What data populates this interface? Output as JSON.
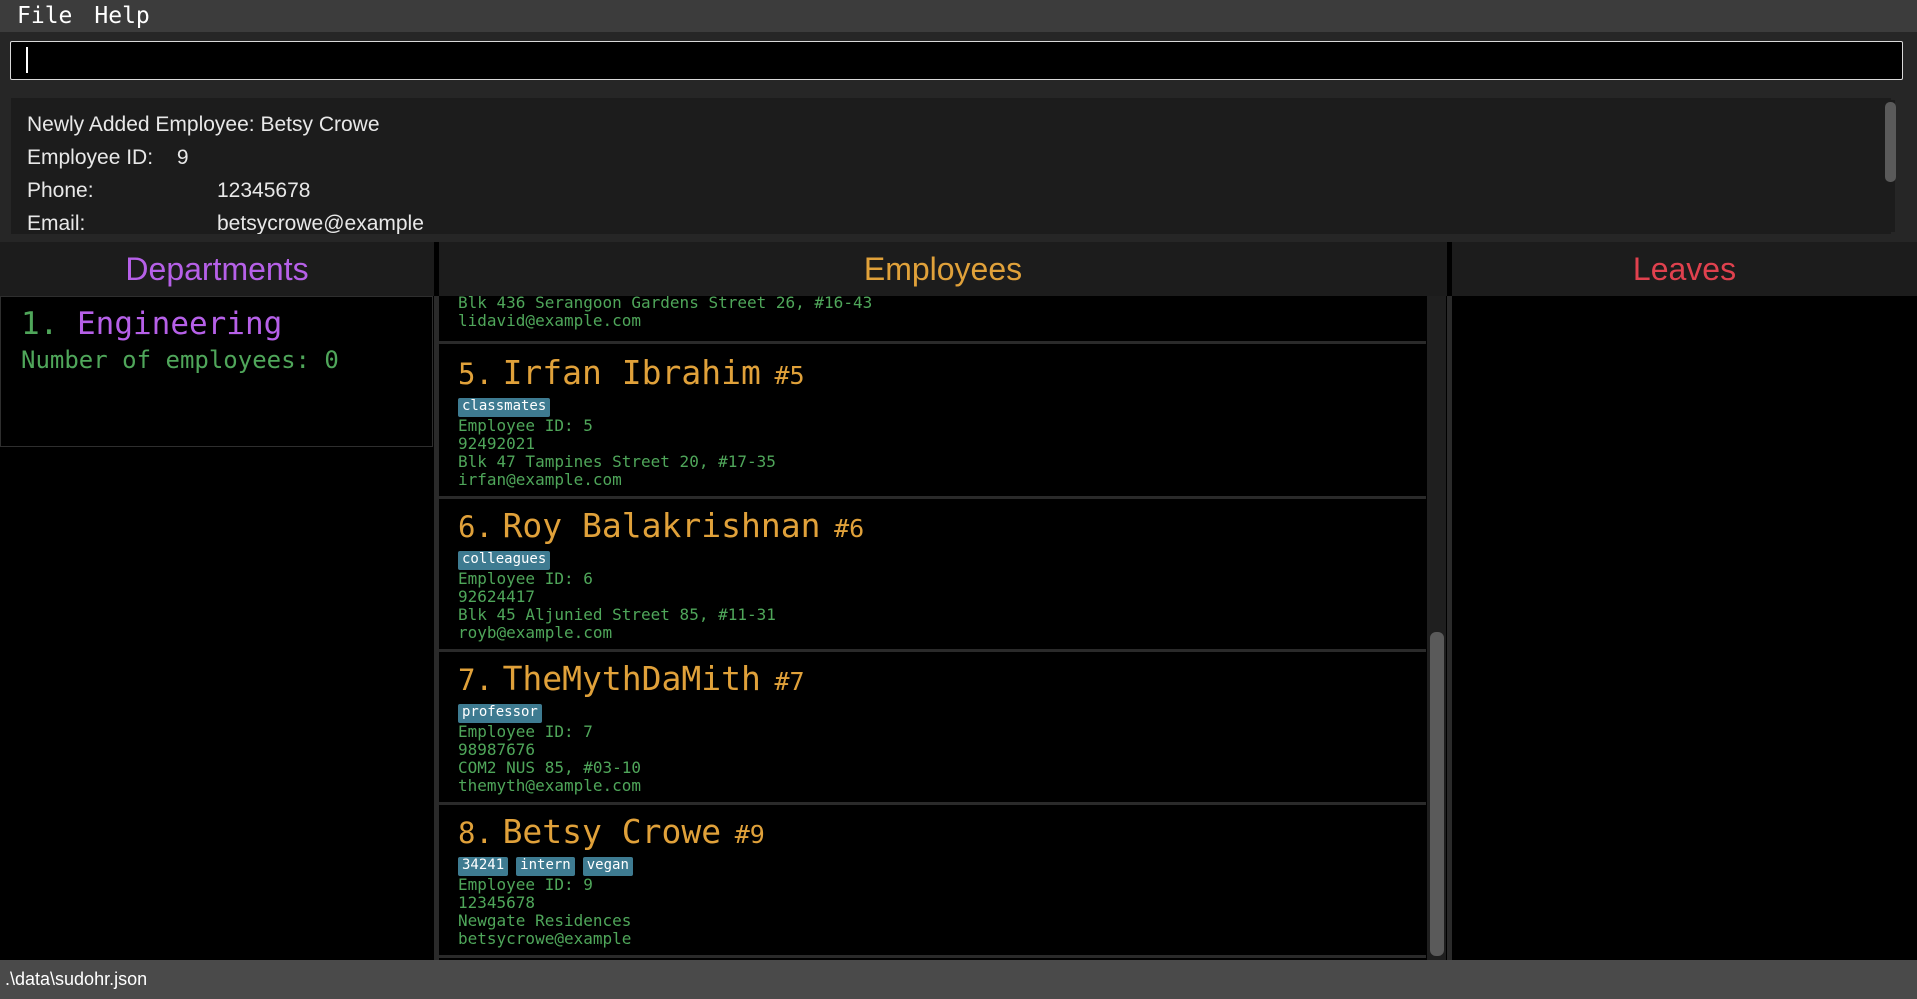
{
  "menu": {
    "file": "File",
    "help": "Help"
  },
  "command": {
    "value": ""
  },
  "result": {
    "line1": "Newly Added Employee: Betsy Crowe",
    "id_label": "Employee ID:",
    "id_value": "9",
    "phone_label": "Phone:",
    "phone_value": "12345678",
    "email_label": "Email:",
    "email_value": "betsycrowe@example"
  },
  "headers": {
    "departments": "Departments",
    "employees": "Employees",
    "leaves": "Leaves",
    "colors": {
      "departments": "#b660e8",
      "employees": "#e0a13a",
      "leaves": "#e0414e"
    }
  },
  "departments": [
    {
      "index": "1.",
      "name": "Engineering",
      "count": "Number of employees: 0"
    }
  ],
  "employees_partial": {
    "address": "Blk 436 Serangoon Gardens Street 26, #16-43",
    "email": "lidavid@example.com"
  },
  "employees": [
    {
      "index": "5.",
      "name": "Irfan Ibrahim",
      "id_tag": "#5",
      "tags": [
        "classmates"
      ],
      "emp_id": "Employee ID: 5",
      "phone": "92492021",
      "address": "Blk 47 Tampines Street 20, #17-35",
      "email": "irfan@example.com"
    },
    {
      "index": "6.",
      "name": "Roy Balakrishnan",
      "id_tag": "#6",
      "tags": [
        "colleagues"
      ],
      "emp_id": "Employee ID: 6",
      "phone": "92624417",
      "address": "Blk 45 Aljunied Street 85, #11-31",
      "email": "royb@example.com"
    },
    {
      "index": "7.",
      "name": "TheMythDaMith",
      "id_tag": "#7",
      "tags": [
        "professor"
      ],
      "emp_id": "Employee ID: 7",
      "phone": "98987676",
      "address": "COM2 NUS 85, #03-10",
      "email": "themyth@example.com"
    },
    {
      "index": "8.",
      "name": "Betsy Crowe",
      "id_tag": "#9",
      "tags": [
        "34241",
        "intern",
        "vegan"
      ],
      "emp_id": "Employee ID: 9",
      "phone": "12345678",
      "address": "Newgate Residences",
      "email": "betsycrowe@example"
    }
  ],
  "status": {
    "path": ".\\data\\sudohr.json"
  }
}
